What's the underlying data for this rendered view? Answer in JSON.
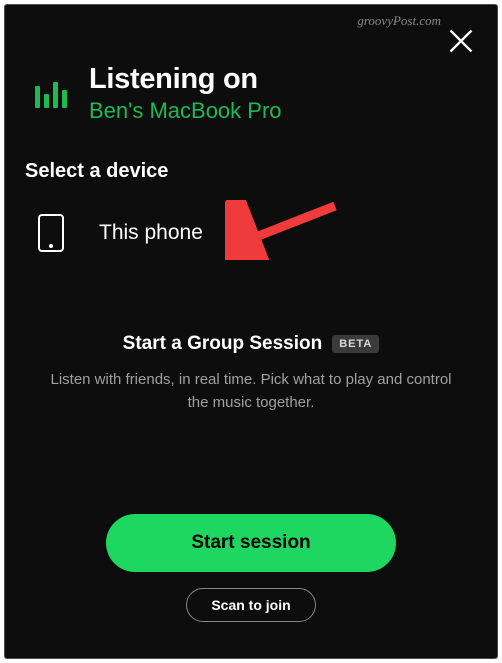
{
  "watermark": "groovyPost.com",
  "header": {
    "title": "Listening on",
    "current_device": "Ben's MacBook Pro"
  },
  "select_label": "Select a device",
  "devices": [
    {
      "name": "This phone"
    }
  ],
  "group_session": {
    "title": "Start a Group Session",
    "badge": "BETA",
    "description": "Listen with friends, in real time. Pick what to play and control the music together."
  },
  "buttons": {
    "primary": "Start session",
    "secondary": "Scan to join"
  },
  "colors": {
    "accent": "#1db954",
    "button": "#1ed760",
    "background": "#0d0d0d"
  }
}
